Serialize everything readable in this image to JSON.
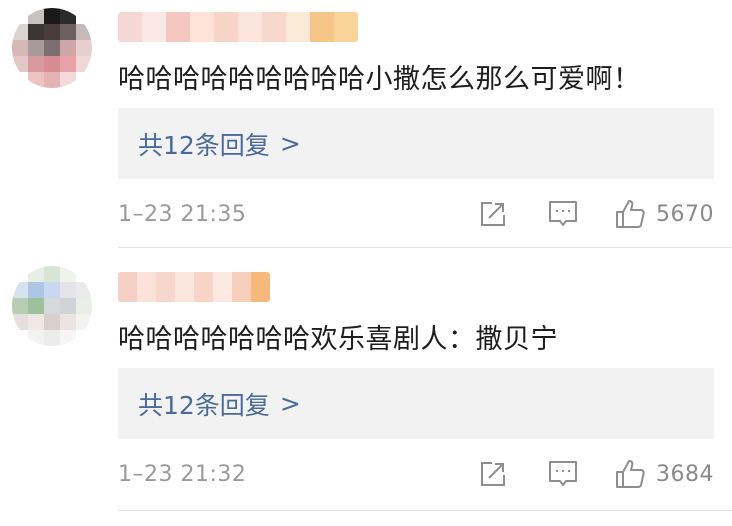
{
  "comments": [
    {
      "username": "",
      "content": "哈哈哈哈哈哈哈哈哈小撒怎么那么可爱啊！",
      "reply_label": "共12条回复",
      "reply_arrow": ">",
      "timestamp": "1–23 21:35",
      "like_count": "5670",
      "icons": {
        "share": "share-icon",
        "reply": "comment-icon",
        "like": "thumbs-up-icon"
      },
      "avatar_colors": [
        "#ffffff",
        "#c9c0c0",
        "#1a1a1a",
        "#2a2a2a",
        "#ffffff",
        "#ddd2d2",
        "#3b3536",
        "#4a3c3d",
        "#6b5f60",
        "#c7b9ba",
        "#d8b7b7",
        "#a89a9b",
        "#7d6e70",
        "#cfa5a8",
        "#e7cfd0",
        "#e2c7c7",
        "#d79a9f",
        "#d68c92",
        "#e8a3a8",
        "#f0d6d7",
        "#ffffff",
        "#ecc2c3",
        "#e5b3b4",
        "#f2dada",
        "#ffffff"
      ],
      "username_colors": [
        "#f7d7d3",
        "#fbe9e6",
        "#f5c7c1",
        "#fde3d8",
        "#f7d3c8",
        "#fbe5dc",
        "#f8d8cc",
        "#fbead6",
        "#f5c688",
        "#f8d49a"
      ]
    },
    {
      "username": "",
      "content": "哈哈哈哈哈哈哈欢乐喜剧人：撒贝宁",
      "reply_label": "共12条回复",
      "reply_arrow": ">",
      "timestamp": "1–23 21:32",
      "like_count": "3684",
      "icons": {
        "share": "share-icon",
        "reply": "comment-icon",
        "like": "thumbs-up-icon"
      },
      "avatar_colors": [
        "#ffffff",
        "#e6efe6",
        "#d5e7d4",
        "#eef4ea",
        "#ffffff",
        "#d7e2ee",
        "#aec6e6",
        "#c8d8ee",
        "#e3e3e8",
        "#eaeaea",
        "#b7cdb3",
        "#9ec09a",
        "#d5d9dc",
        "#cfd3d6",
        "#e9eee6",
        "#e6dede",
        "#f0e8e6",
        "#d9cfcc",
        "#eae5e3",
        "#f3f3f3",
        "#ffffff",
        "#f2f2f2",
        "#ececec",
        "#f5f5f5",
        "#ffffff"
      ],
      "username_colors": [
        "#f6cfc6",
        "#fbe3dc",
        "#f7d6cd",
        "#fde6de",
        "#f8d4c8",
        "#fbe8e0",
        "#f7cdbb",
        "#f6b97b"
      ]
    }
  ]
}
